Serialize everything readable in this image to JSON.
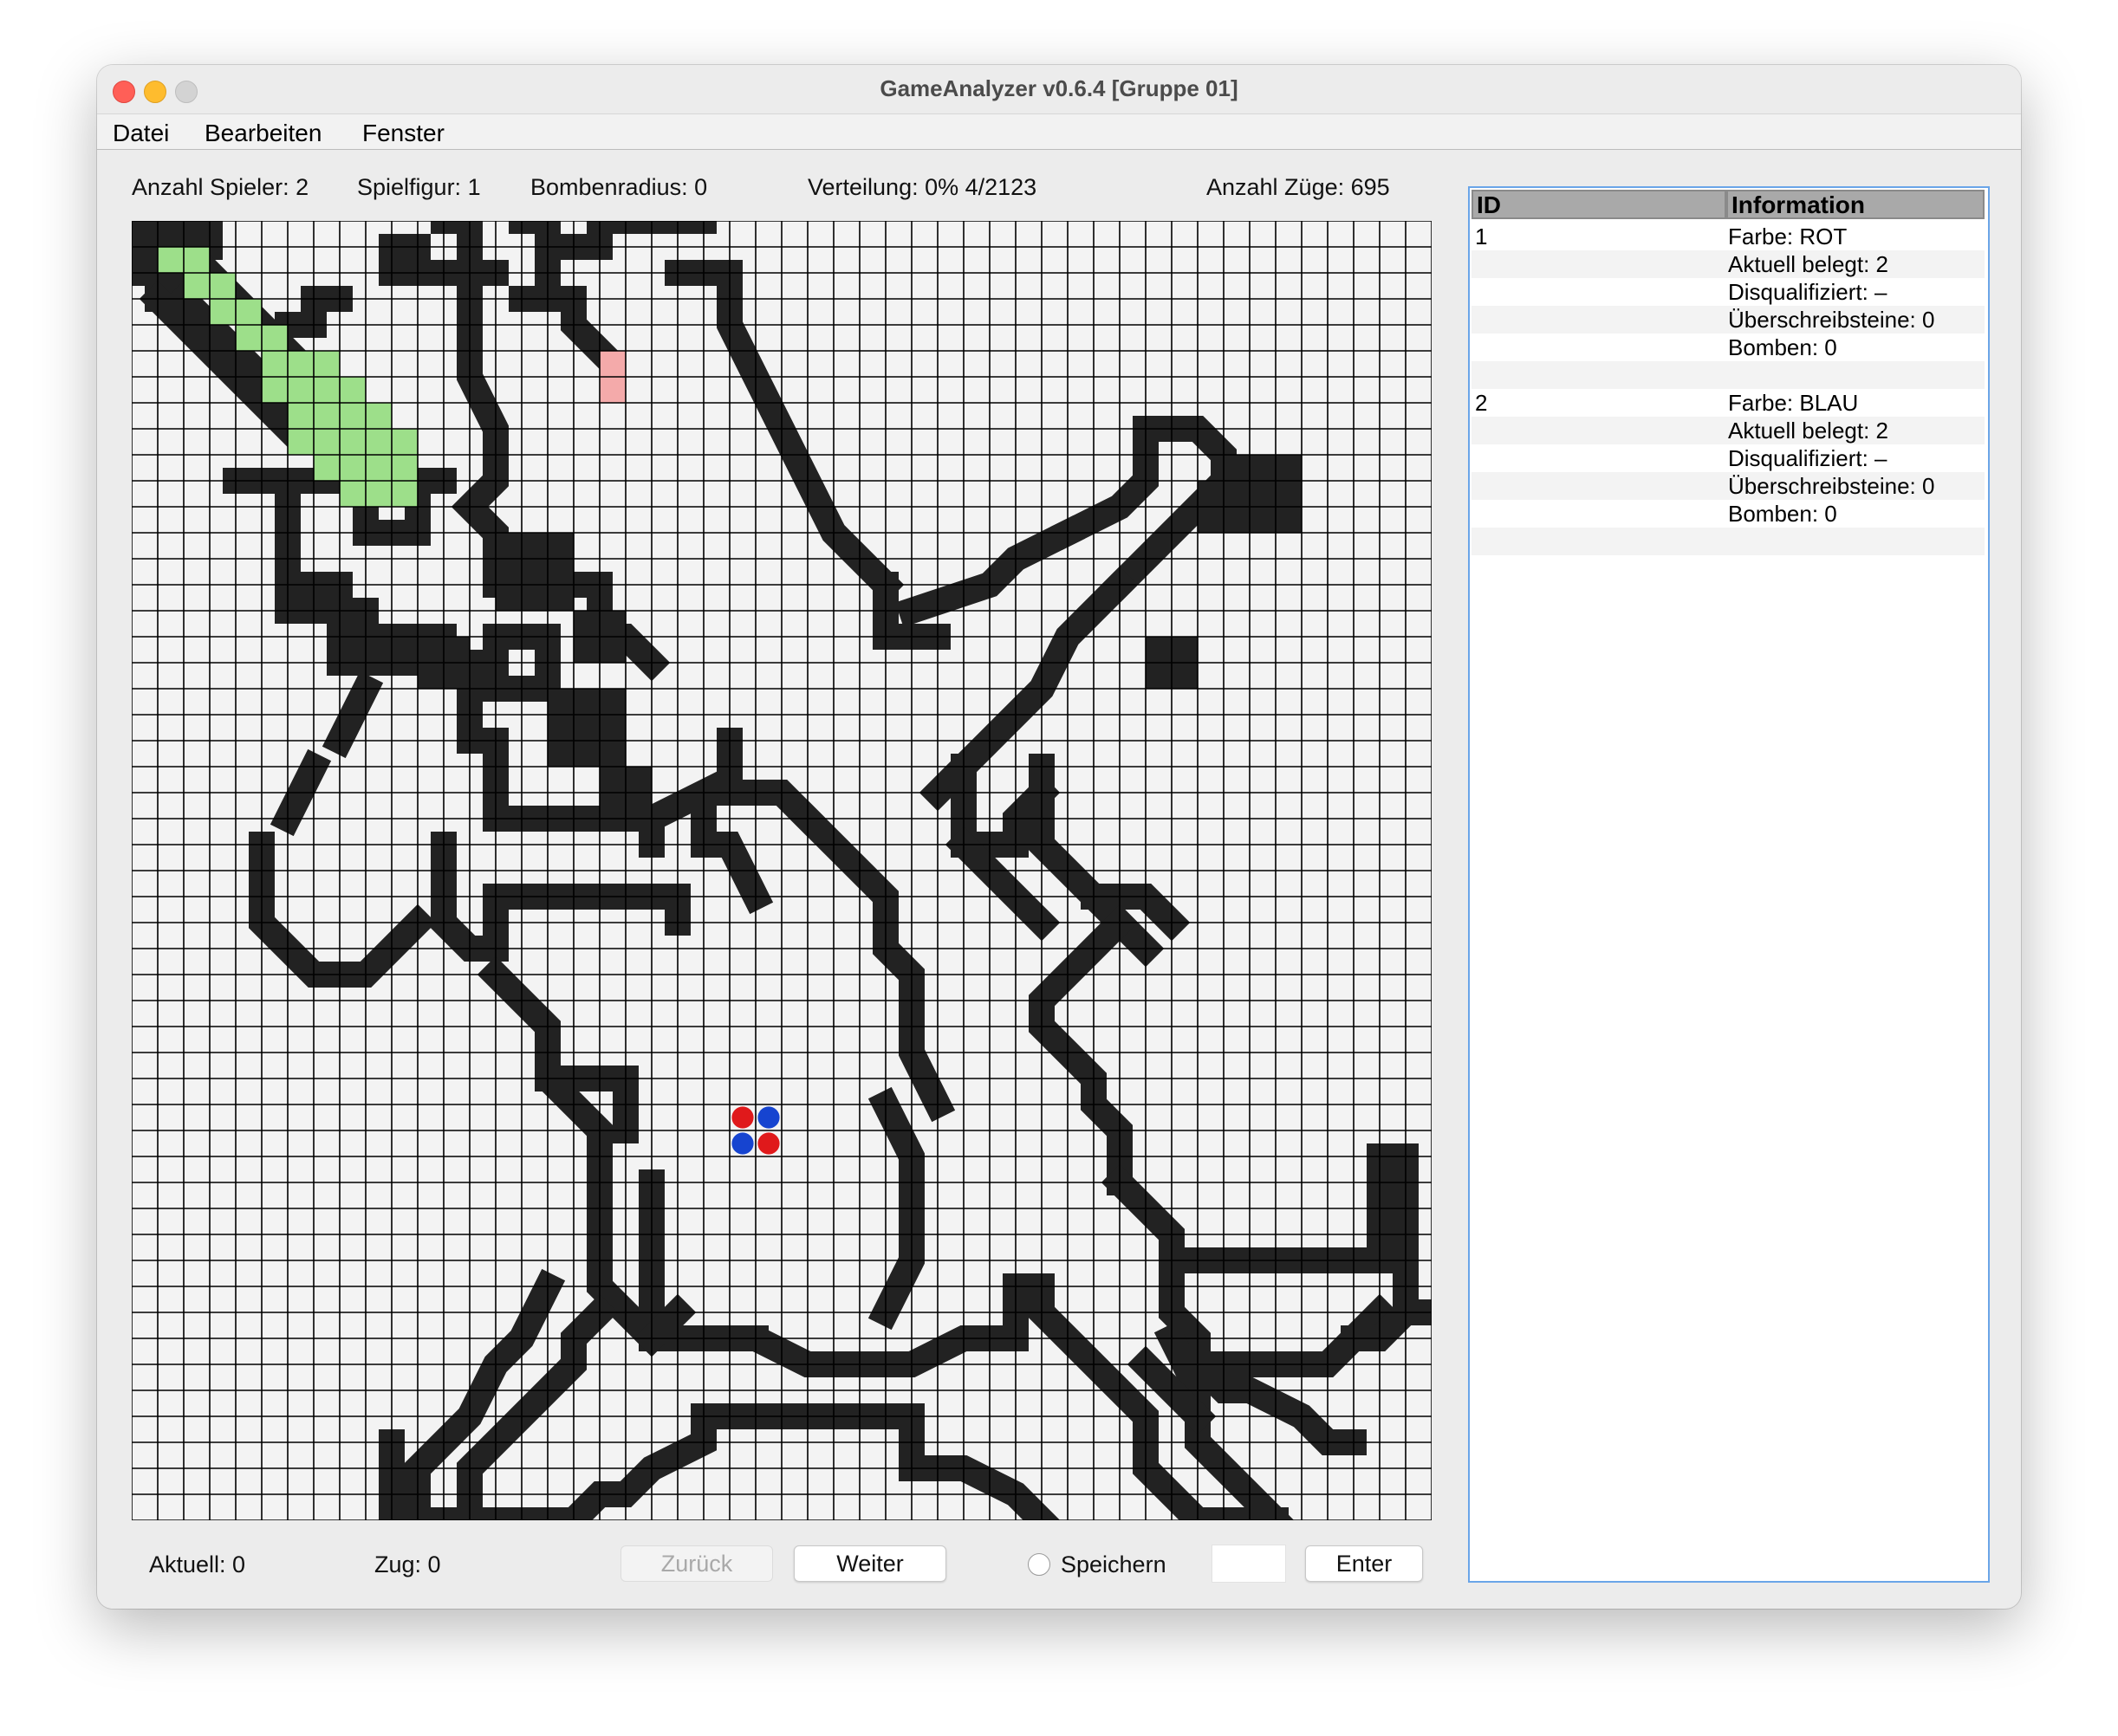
{
  "window": {
    "title": "GameAnalyzer v0.6.4  [Gruppe 01]"
  },
  "menu": [
    "Datei",
    "Bearbeiten",
    "Fenster"
  ],
  "info": {
    "players": "Anzahl Spieler: 2",
    "figure": "Spielfigur: 1",
    "bomb_radius": "Bombenradius: 0",
    "distribution": "Verteilung: 0% 4/2123",
    "moves": "Anzahl Züge: 695"
  },
  "board": {
    "rows": 50,
    "cols": 50,
    "colors": {
      "empty": "#f3f3f3",
      "wall": "#222222",
      "green": "#9ddf8a",
      "pink": "#f4aaaa",
      "red": "#e0191b",
      "blue": "#1644d0",
      "grid": "#000000"
    },
    "green_cells": [
      [
        1,
        1
      ],
      [
        1,
        2
      ],
      [
        2,
        2
      ],
      [
        2,
        3
      ],
      [
        3,
        3
      ],
      [
        3,
        4
      ],
      [
        4,
        4
      ],
      [
        4,
        5
      ],
      [
        5,
        5
      ],
      [
        5,
        6
      ],
      [
        5,
        7
      ],
      [
        6,
        5
      ],
      [
        6,
        6
      ],
      [
        6,
        7
      ],
      [
        6,
        8
      ],
      [
        7,
        6
      ],
      [
        7,
        7
      ],
      [
        7,
        8
      ],
      [
        7,
        9
      ],
      [
        8,
        6
      ],
      [
        8,
        7
      ],
      [
        8,
        8
      ],
      [
        8,
        9
      ],
      [
        8,
        10
      ],
      [
        9,
        7
      ],
      [
        9,
        8
      ],
      [
        9,
        9
      ],
      [
        9,
        10
      ],
      [
        10,
        8
      ],
      [
        10,
        9
      ],
      [
        10,
        10
      ]
    ],
    "pink_cells": [
      [
        5,
        18
      ],
      [
        6,
        18
      ]
    ],
    "pieces": [
      {
        "row": 34,
        "col": 23,
        "player": "red"
      },
      {
        "row": 34,
        "col": 24,
        "player": "blue"
      },
      {
        "row": 35,
        "col": 23,
        "player": "blue"
      },
      {
        "row": 35,
        "col": 24,
        "player": "red"
      }
    ]
  },
  "bottom": {
    "current": "Aktuell: 0",
    "turn": "Zug: 0",
    "back_label": "Zurück",
    "next_label": "Weiter",
    "save_label": "Speichern",
    "enter_label": "Enter",
    "input_value": ""
  },
  "table": {
    "headers": [
      "ID",
      "Information"
    ],
    "rows": [
      {
        "id": "1",
        "info": "Farbe: ROT"
      },
      {
        "id": "",
        "info": "Aktuell belegt: 2"
      },
      {
        "id": "",
        "info": "Disqualifiziert: –"
      },
      {
        "id": "",
        "info": "Überschreibsteine: 0"
      },
      {
        "id": "",
        "info": "Bomben: 0"
      },
      {
        "id": "",
        "info": ""
      },
      {
        "id": "2",
        "info": "Farbe: BLAU"
      },
      {
        "id": "",
        "info": "Aktuell belegt: 2"
      },
      {
        "id": "",
        "info": "Disqualifiziert: –"
      },
      {
        "id": "",
        "info": "Überschreibsteine: 0"
      },
      {
        "id": "",
        "info": "Bomben: 0"
      },
      {
        "id": "",
        "info": ""
      }
    ]
  }
}
